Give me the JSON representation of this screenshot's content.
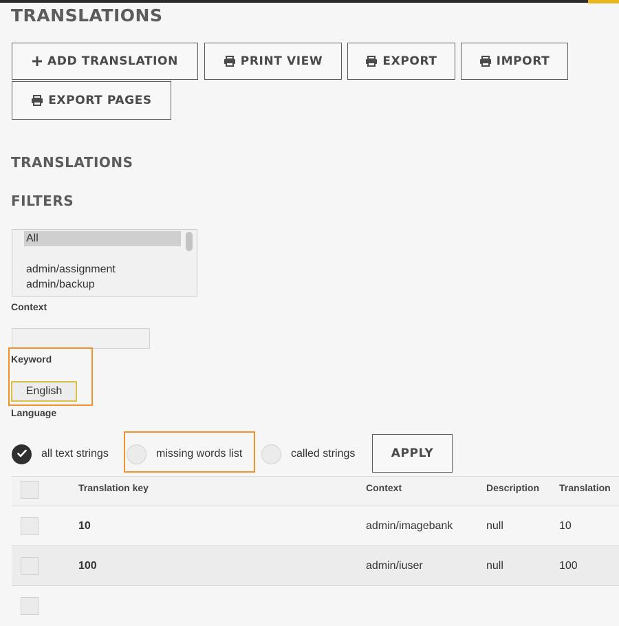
{
  "page": {
    "title": "TRANSLATIONS",
    "section_title": "TRANSLATIONS",
    "filters_title": "FILTERS"
  },
  "toolbar": {
    "add_translation": "ADD TRANSLATION",
    "print_view": "PRINT VIEW",
    "export": "EXPORT",
    "import": "IMPORT",
    "export_pages": "EXPORT PAGES"
  },
  "filters": {
    "context_options": [
      "All",
      "",
      "admin/assignment",
      "admin/backup"
    ],
    "context_selected": "All",
    "context_label": "Context",
    "keyword_label": "Keyword",
    "keyword_value": "",
    "language_value": "English",
    "language_label": "Language",
    "radio_options": [
      {
        "label": "all text strings",
        "checked": true
      },
      {
        "label": "missing words list",
        "checked": false
      },
      {
        "label": "called strings",
        "checked": false
      }
    ],
    "apply_label": "APPLY"
  },
  "table": {
    "columns": [
      "Translation key",
      "Context",
      "Description",
      "Translation"
    ],
    "rows": [
      {
        "key": "10",
        "context": "admin/imagebank",
        "description": "null",
        "translation": "10"
      },
      {
        "key": "100",
        "context": "admin/iuser",
        "description": "null",
        "translation": "100"
      }
    ]
  },
  "colors": {
    "highlight": "#f3922a",
    "accent": "#e8b51e",
    "language_border": "#dcbf47"
  }
}
